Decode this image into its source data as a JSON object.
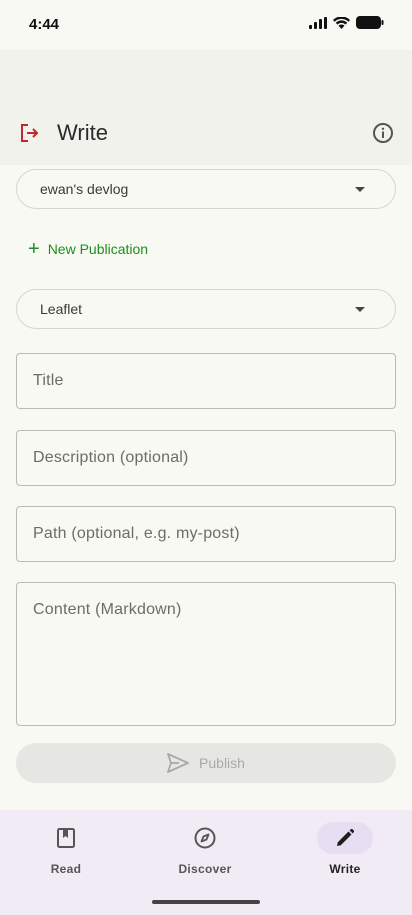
{
  "status_bar": {
    "time": "4:44"
  },
  "header": {
    "title": "Write"
  },
  "publication_select": {
    "value": "ewan's devlog"
  },
  "new_publication": {
    "label": "New Publication"
  },
  "platform_select": {
    "value": "Leaflet"
  },
  "form": {
    "title_placeholder": "Title",
    "description_placeholder": "Description (optional)",
    "path_placeholder": "Path (optional, e.g. my-post)",
    "content_placeholder": "Content (Markdown)"
  },
  "publish": {
    "label": "Publish",
    "enabled": false
  },
  "bottom_nav": {
    "items": [
      {
        "label": "Read",
        "icon": "book-icon"
      },
      {
        "label": "Discover",
        "icon": "compass-icon"
      },
      {
        "label": "Write",
        "icon": "pencil-icon",
        "active": true
      }
    ]
  },
  "colors": {
    "accent_green": "#1e8e1e",
    "logout_red": "#c0282d",
    "nav_background": "#f1ebf6",
    "nav_active_pill": "#e7def3"
  }
}
